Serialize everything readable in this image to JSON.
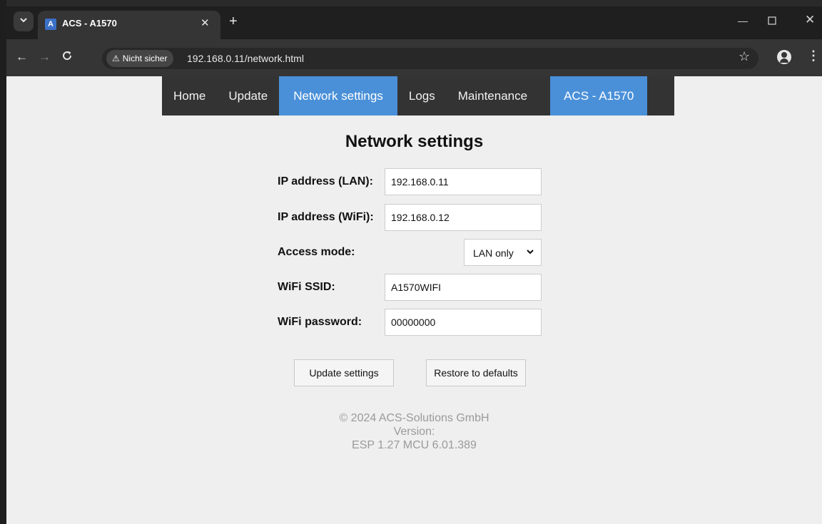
{
  "browser": {
    "tab_title": "ACS - A1570",
    "favicon_letter": "A",
    "security_label": "Nicht sicher",
    "url": "192.168.0.11/network.html",
    "icons": [
      "chevron-down-icon",
      "close-icon",
      "plus-icon",
      "minimize-icon",
      "maximize-icon",
      "window-close-icon",
      "back-arrow-icon",
      "forward-arrow-icon",
      "reload-icon",
      "warning-icon",
      "star-icon",
      "profile-icon",
      "kebab-menu-icon"
    ]
  },
  "nav": {
    "items": [
      {
        "label": "Home"
      },
      {
        "label": "Update"
      },
      {
        "label": "Network settings"
      },
      {
        "label": "Logs"
      },
      {
        "label": "Maintenance"
      }
    ],
    "brand": "ACS - A1570",
    "active_color": "#4a90d9"
  },
  "page": {
    "title": "Network settings",
    "fields": {
      "ip_lan": {
        "label": "IP address (LAN):",
        "value": "192.168.0.11"
      },
      "ip_wifi": {
        "label": "IP address (WiFi):",
        "value": "192.168.0.12"
      },
      "access_mode": {
        "label": "Access mode:",
        "value": "LAN only"
      },
      "wifi_ssid": {
        "label": "WiFi SSID:",
        "value": "A1570WIFI"
      },
      "wifi_password": {
        "label": "WiFi password:",
        "value": "00000000"
      }
    },
    "buttons": {
      "update": "Update settings",
      "restore": "Restore to defaults"
    },
    "footer": {
      "copyright": "© 2024 ACS-Solutions GmbH",
      "version_label": "Version:",
      "version_value": "ESP 1.27 MCU 6.01.389"
    }
  }
}
